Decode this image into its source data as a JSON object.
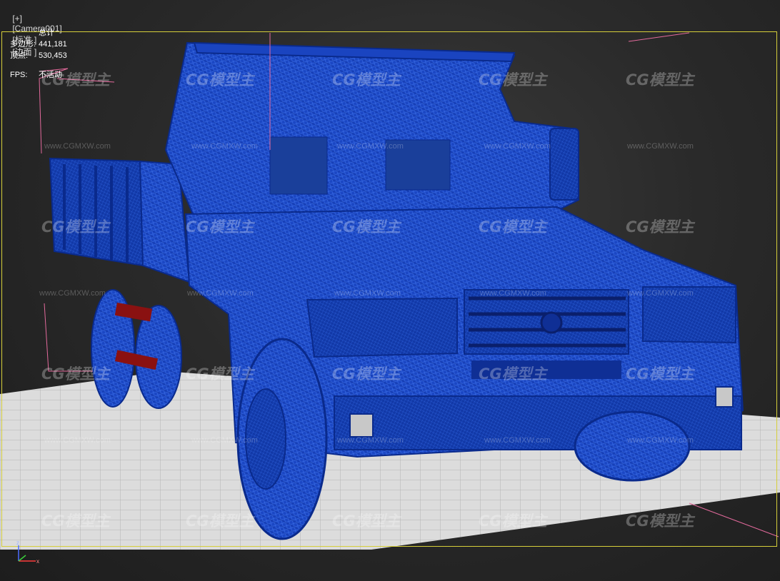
{
  "viewport": {
    "label_parts": [
      "[+]",
      "[Camera001]",
      "[标准 ]",
      "[边面 ]"
    ],
    "stats": {
      "header": "总计",
      "polygons_label": "多边形:",
      "polygons_value": "441,181",
      "vertices_label": "顶点:",
      "vertices_value": "530,453",
      "fps_label": "FPS:",
      "fps_value": "不活动"
    },
    "watermark_logo": "CG模型主",
    "watermark_url": "www.CGMXW.com",
    "axis_gizmo": {
      "z": "z",
      "x": "x"
    }
  },
  "colors": {
    "wireframe": "#1f4fd0",
    "active_border": "#d6cf3a",
    "ground_grid": "#d9d9d9",
    "background": "#2e2e2e"
  }
}
